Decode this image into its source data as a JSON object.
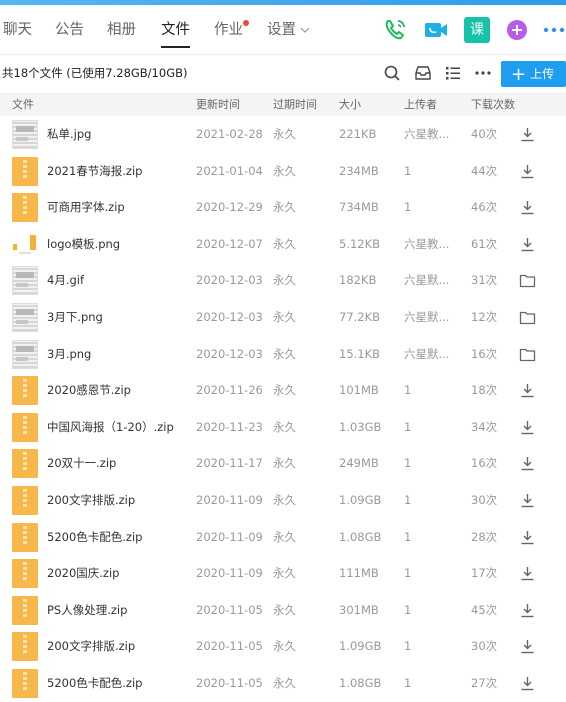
{
  "tabs": [
    {
      "label": "聊天",
      "active": false
    },
    {
      "label": "公告",
      "active": false
    },
    {
      "label": "相册",
      "active": false
    },
    {
      "label": "文件",
      "active": true
    },
    {
      "label": "作业",
      "active": false,
      "badge_dot": true
    },
    {
      "label": "设置",
      "active": false,
      "dropdown": true
    }
  ],
  "tab_actions": [
    {
      "icon": "phone-call-icon",
      "color": "#21b95a"
    },
    {
      "icon": "video-call-icon",
      "color": "#1fb0e6"
    },
    {
      "icon": "lesson-icon",
      "label": "课",
      "color": "#16c2a8"
    },
    {
      "icon": "add-app-icon",
      "color": "#b85ce6"
    },
    {
      "icon": "more-icon",
      "color": "#3b8fe0"
    }
  ],
  "toolbar": {
    "summary": "共18个文件 (已使用7.28GB/10GB)",
    "upload_label": "上传",
    "icons": [
      "search-icon",
      "inbox-icon",
      "list-view-icon",
      "more-icon"
    ]
  },
  "columns": [
    "文件",
    "更新时间",
    "过期时间",
    "大小",
    "上传者",
    "下载次数"
  ],
  "files": [
    {
      "name": "私单.jpg",
      "date": "2021-02-28",
      "expire": "永久",
      "size": "221KB",
      "uploader": "六星教...",
      "downloads": "40次",
      "type": "image",
      "action": "download"
    },
    {
      "name": "2021春节海报.zip",
      "date": "2021-01-04",
      "expire": "永久",
      "size": "234MB",
      "uploader": "1",
      "downloads": "44次",
      "type": "zip",
      "action": "download"
    },
    {
      "name": "可商用字体.zip",
      "date": "2020-12-29",
      "expire": "永久",
      "size": "734MB",
      "uploader": "1",
      "downloads": "46次",
      "type": "zip",
      "action": "download"
    },
    {
      "name": "logo模板.png",
      "date": "2020-12-07",
      "expire": "永久",
      "size": "5.12KB",
      "uploader": "六星教...",
      "downloads": "61次",
      "type": "logo",
      "action": "download"
    },
    {
      "name": "4月.gif",
      "date": "2020-12-03",
      "expire": "永久",
      "size": "182KB",
      "uploader": "六星默...",
      "downloads": "31次",
      "type": "image",
      "action": "folder"
    },
    {
      "name": "3月下.png",
      "date": "2020-12-03",
      "expire": "永久",
      "size": "77.2KB",
      "uploader": "六星默...",
      "downloads": "12次",
      "type": "image",
      "action": "folder"
    },
    {
      "name": "3月.png",
      "date": "2020-12-03",
      "expire": "永久",
      "size": "15.1KB",
      "uploader": "六星默...",
      "downloads": "16次",
      "type": "image",
      "action": "folder"
    },
    {
      "name": "2020感恩节.zip",
      "date": "2020-11-26",
      "expire": "永久",
      "size": "101MB",
      "uploader": "1",
      "downloads": "18次",
      "type": "zip",
      "action": "download"
    },
    {
      "name": "中国风海报（1-20）.zip",
      "date": "2020-11-23",
      "expire": "永久",
      "size": "1.03GB",
      "uploader": "1",
      "downloads": "34次",
      "type": "zip",
      "action": "download"
    },
    {
      "name": "20双十一.zip",
      "date": "2020-11-17",
      "expire": "永久",
      "size": "249MB",
      "uploader": "1",
      "downloads": "16次",
      "type": "zip",
      "action": "download"
    },
    {
      "name": "200文字排版.zip",
      "date": "2020-11-09",
      "expire": "永久",
      "size": "1.09GB",
      "uploader": "1",
      "downloads": "30次",
      "type": "zip",
      "action": "download"
    },
    {
      "name": "5200色卡配色.zip",
      "date": "2020-11-09",
      "expire": "永久",
      "size": "1.08GB",
      "uploader": "1",
      "downloads": "28次",
      "type": "zip",
      "action": "download"
    },
    {
      "name": "2020国庆.zip",
      "date": "2020-11-09",
      "expire": "永久",
      "size": "111MB",
      "uploader": "1",
      "downloads": "17次",
      "type": "zip",
      "action": "download"
    },
    {
      "name": "PS人像处理.zip",
      "date": "2020-11-05",
      "expire": "永久",
      "size": "301MB",
      "uploader": "1",
      "downloads": "45次",
      "type": "zip",
      "action": "download"
    },
    {
      "name": "200文字排版.zip",
      "date": "2020-11-05",
      "expire": "永久",
      "size": "1.09GB",
      "uploader": "1",
      "downloads": "30次",
      "type": "zip",
      "action": "download"
    },
    {
      "name": "5200色卡配色.zip",
      "date": "2020-11-05",
      "expire": "永久",
      "size": "1.08GB",
      "uploader": "1",
      "downloads": "27次",
      "type": "zip",
      "action": "download"
    }
  ],
  "colors": {
    "accent": "#1f9ef0",
    "zip": "#f7b74a",
    "badge": "#f2453d"
  }
}
